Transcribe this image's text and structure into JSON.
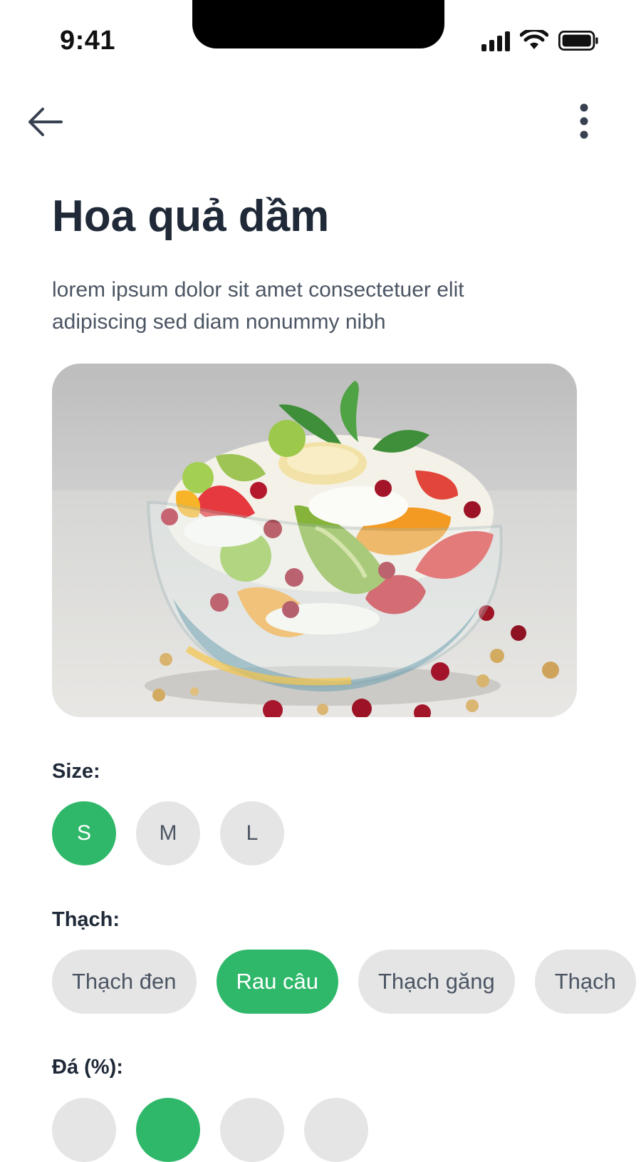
{
  "status_bar": {
    "time": "9:41"
  },
  "product": {
    "title": "Hoa quả dầm",
    "description": "lorem ipsum dolor sit amet consectetuer elit adipiscing sed diam nonummy nibh"
  },
  "size": {
    "label": "Size:",
    "options": [
      {
        "label": "S",
        "selected": true
      },
      {
        "label": "M",
        "selected": false
      },
      {
        "label": "L",
        "selected": false
      }
    ]
  },
  "jelly": {
    "label": "Thạch:",
    "options": [
      {
        "label": "Thạch đen",
        "selected": false
      },
      {
        "label": "Rau câu",
        "selected": true
      },
      {
        "label": "Thạch găng",
        "selected": false
      },
      {
        "label": "Thạch",
        "selected": false
      }
    ]
  },
  "ice": {
    "label": "Đá (%):",
    "options": [
      {
        "label": "",
        "selected": false
      },
      {
        "label": "",
        "selected": true
      },
      {
        "label": "",
        "selected": false
      },
      {
        "label": "",
        "selected": false
      }
    ]
  },
  "colors": {
    "accent": "#2fb86a",
    "chip_bg": "#e5e5e5",
    "text_dark": "#1f2937",
    "text_muted": "#4b5563"
  },
  "icons": {
    "back": "arrow-left-icon",
    "more": "more-vertical-icon"
  }
}
